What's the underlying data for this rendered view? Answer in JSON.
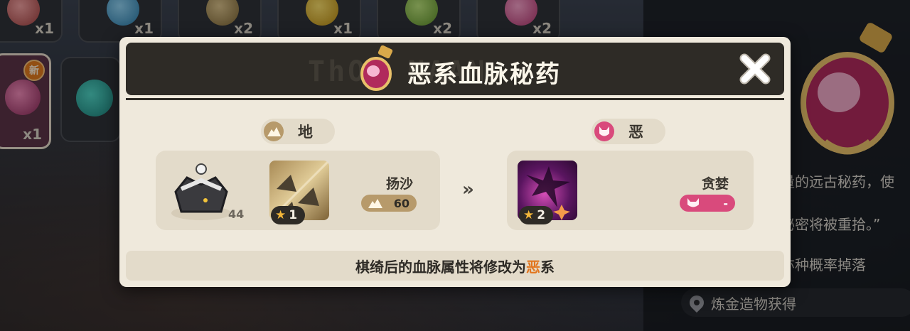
{
  "inventory": {
    "top_counts": [
      "x1",
      "x1",
      "x2",
      "x1",
      "x2",
      "x2"
    ],
    "selected_count": "x1",
    "new_badge": "新"
  },
  "modal": {
    "title": "恶系血脉秘药",
    "watermark": "ThOX  NAAN",
    "before": {
      "element_label": "地",
      "level_badge": "44",
      "skill_name": "扬沙",
      "skill_level": "1",
      "power_value": "60"
    },
    "after": {
      "element_label": "恶",
      "skill_name": "贪婪",
      "skill_level": "2",
      "power_value": "-"
    },
    "arrow": "»",
    "footer": {
      "prefix": "棋绮后的血脉属性将修改为",
      "highlight": "恶",
      "suffix": "系"
    }
  },
  "detail_panel": {
    "desc_line_1": "量的远古秘药，使",
    "desc_line_2": "秘密将被重拾。”",
    "drop_line": "亦种概率掉落",
    "source_label": "炼金造物获得"
  },
  "colors": {
    "accent_orange": "#e2761e",
    "dark_header": "#2e2b26",
    "modal_bg": "#efe9dc",
    "earth_pill": "#b79a6b",
    "dark_pill": "#d94a7c"
  }
}
